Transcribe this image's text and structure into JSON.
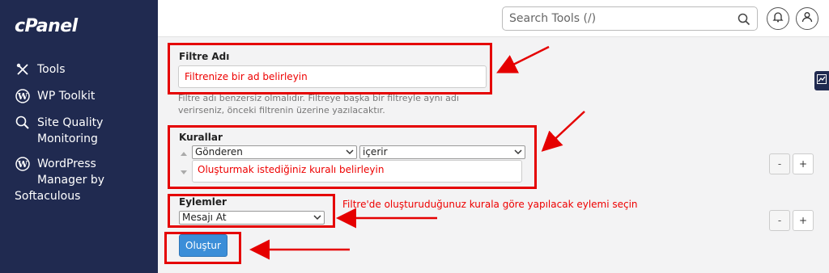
{
  "sidebar": {
    "logo": "cPanel",
    "items": [
      {
        "label": "Tools",
        "icon": "tools-icon"
      },
      {
        "label": "WP Toolkit",
        "icon": "wordpress-icon"
      },
      {
        "label": "Site Quality\nMonitoring",
        "icon": "search-icon"
      },
      {
        "label": "WordPress\nManager by",
        "label_extra": "Softaculous",
        "icon": "wordpress-icon"
      }
    ]
  },
  "header": {
    "search_placeholder": "Search Tools (/)"
  },
  "form": {
    "filter_name_label": "Filtre Adı",
    "filter_name_placeholder": "Filtrenize bir ad belirleyin",
    "filter_help": "Filtre adı benzersiz olmalıdır. Filtreye başka bir filtreyle aynı adı verirseniz, önceki filtrenin üzerine yazılacaktır.",
    "rules_label": "Kurallar",
    "rule_field_select": "Gönderen",
    "rule_op_select": "içerir",
    "rule_value_placeholder": "Oluşturmak istediğiniz kuralı belirleyin",
    "actions_label": "Eylemler",
    "action_select": "Mesajı At",
    "submit_label": "Oluştur",
    "minus_label": "-",
    "plus_label": "+"
  },
  "annotations": {
    "action_hint": "Filtre'de oluşturuduğunuz kurala göre yapılacak eylemi seçin",
    "highlight_color": "#e50000"
  },
  "colors": {
    "sidebar_bg": "#202a50",
    "primary_button": "#3b8ed8"
  }
}
